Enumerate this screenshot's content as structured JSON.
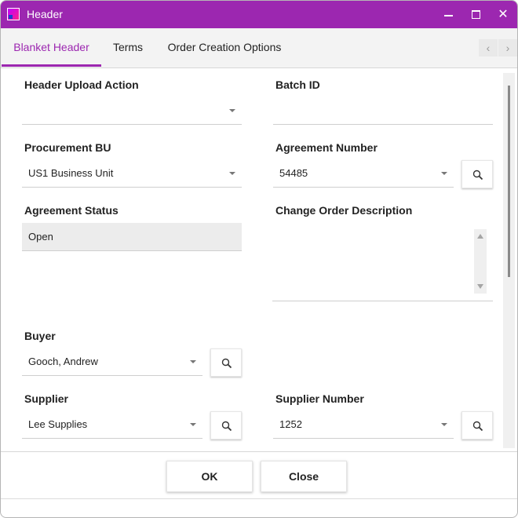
{
  "window": {
    "title": "Header",
    "colors": {
      "accent": "#9c27b0",
      "tabbar_bg": "#f3f3f3",
      "readonly_bg": "#ececec"
    },
    "controls": {
      "minimize": "minimize-icon",
      "maximize": "maximize-icon",
      "close": "close-icon"
    }
  },
  "tabs": [
    {
      "label": "Blanket Header",
      "active": true
    },
    {
      "label": "Terms",
      "active": false
    },
    {
      "label": "Order Creation Options",
      "active": false
    }
  ],
  "tab_nav": {
    "prev": "‹",
    "next": "›"
  },
  "form": {
    "header_upload_action": {
      "label": "Header Upload Action",
      "value": ""
    },
    "batch_id": {
      "label": "Batch ID",
      "value": ""
    },
    "procurement_bu": {
      "label": "Procurement BU",
      "value": "US1 Business Unit"
    },
    "agreement_number": {
      "label": "Agreement Number",
      "value": "54485"
    },
    "agreement_status": {
      "label": "Agreement Status",
      "value": "Open"
    },
    "change_order_description": {
      "label": "Change Order Description",
      "value": ""
    },
    "buyer": {
      "label": "Buyer",
      "value": "Gooch, Andrew"
    },
    "supplier": {
      "label": "Supplier",
      "value": "Lee Supplies"
    },
    "supplier_number": {
      "label": "Supplier Number",
      "value": "1252"
    }
  },
  "footer": {
    "ok_label": "OK",
    "close_label": "Close"
  }
}
